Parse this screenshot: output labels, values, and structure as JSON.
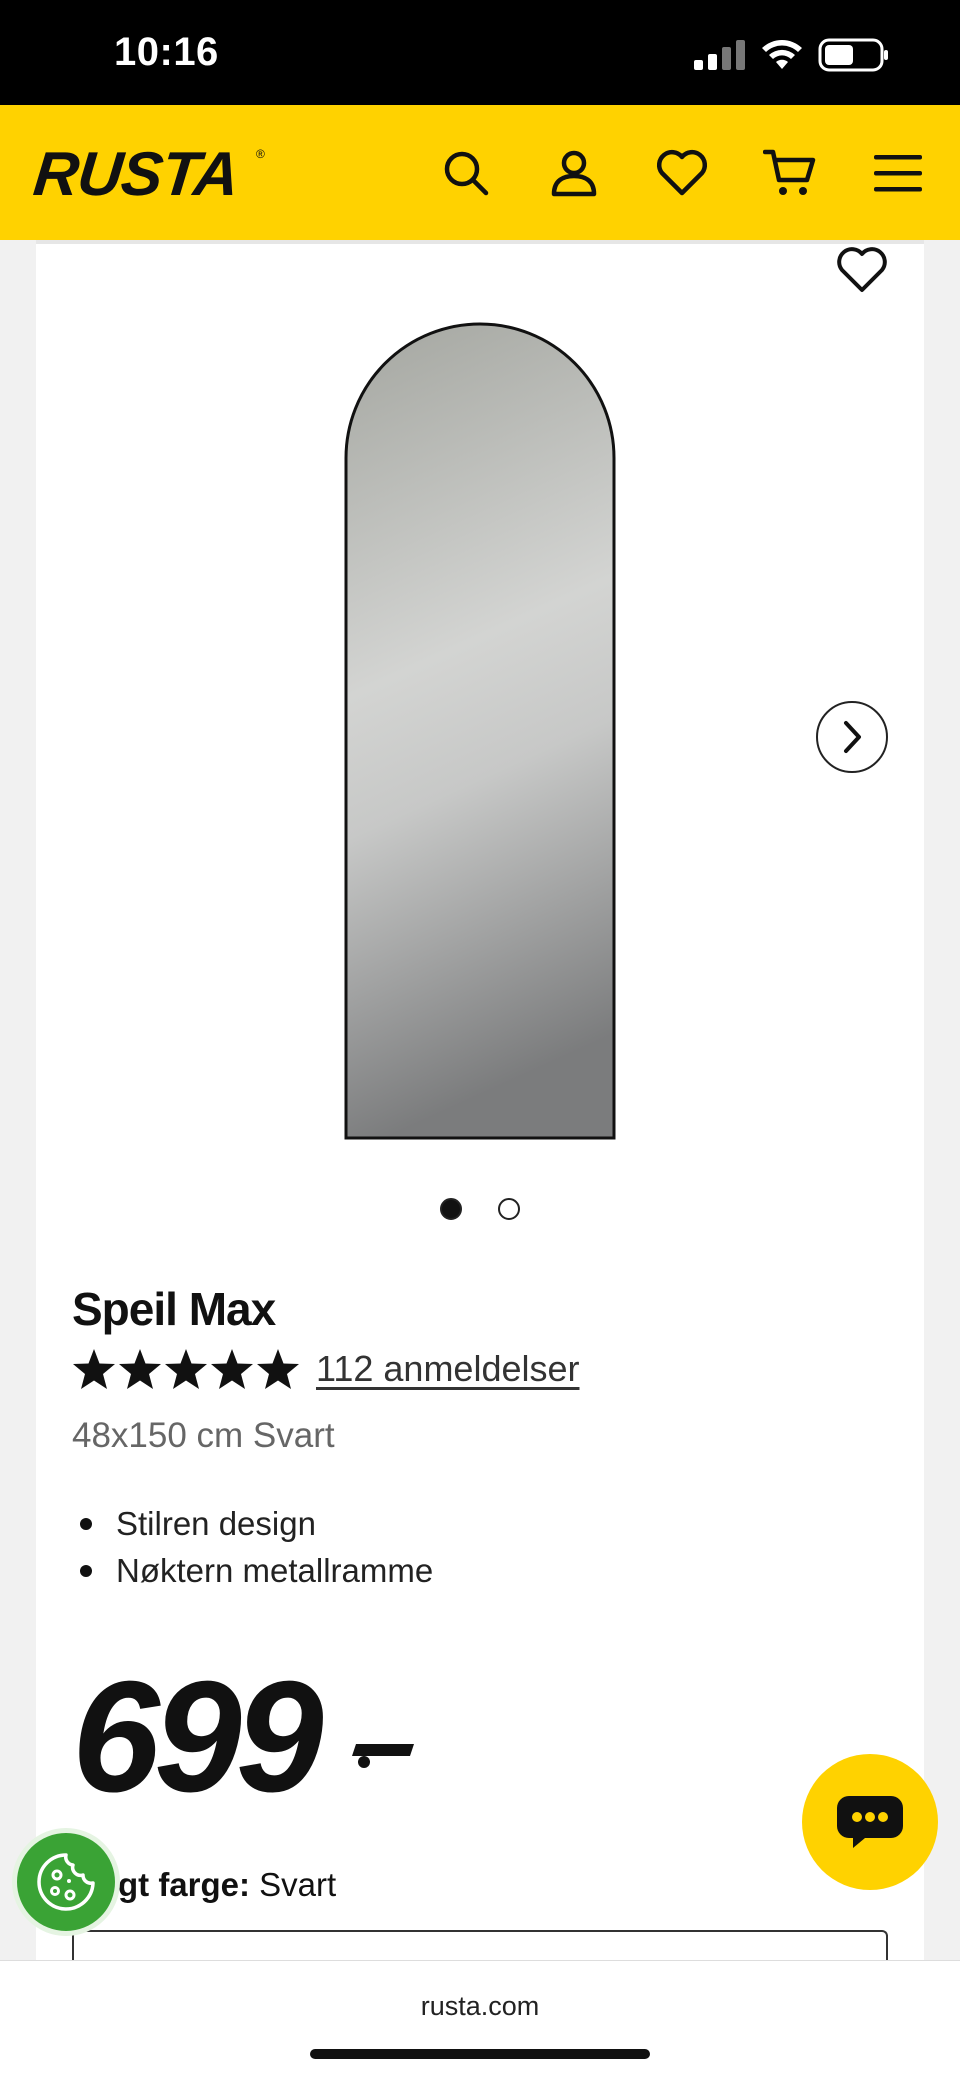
{
  "status_bar": {
    "time": "10:16"
  },
  "header": {
    "logo": "RUSTA",
    "logo_mark": "®",
    "accent_color": "#ffd200"
  },
  "product": {
    "title": "Speil Max",
    "rating": 5,
    "reviews_label": "112 anmeldelser",
    "subtitle": "48x150 cm Svart",
    "features": [
      "Stilren design",
      "Nøktern metallramme"
    ],
    "price": "699"
  },
  "gallery": {
    "image_count": 2,
    "active_index": 0
  },
  "color_select": {
    "label": "gt farge:",
    "value": "Svart"
  },
  "browser": {
    "url": "rusta.com"
  },
  "icons": [
    "search-icon",
    "user-icon",
    "heart-icon",
    "cart-icon",
    "menu-icon",
    "chevron-right-icon",
    "cookie-icon",
    "chat-icon"
  ]
}
